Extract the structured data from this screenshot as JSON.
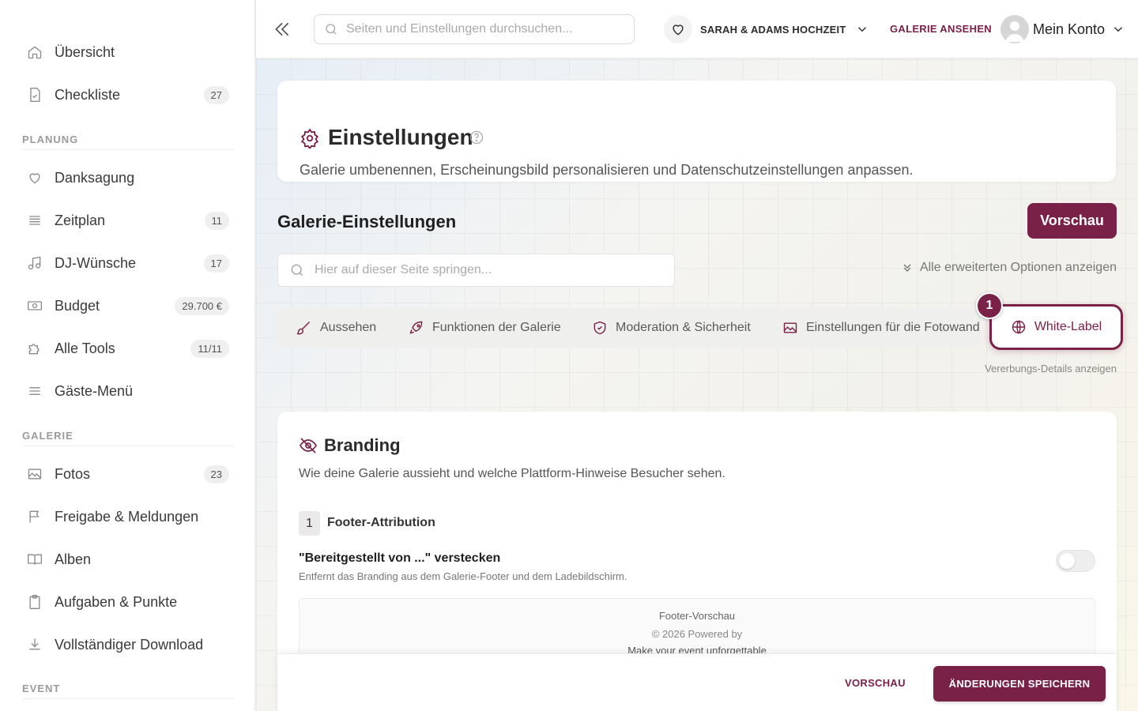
{
  "sidebar": {
    "items": [
      {
        "label": "Übersicht",
        "icon": "home-icon"
      },
      {
        "label": "Checkliste",
        "icon": "checklist-icon",
        "badge": "27"
      },
      {
        "label": "Danksagung",
        "icon": "heart-icon"
      },
      {
        "label": "Zeitplan",
        "icon": "schedule-icon",
        "badge": "11"
      },
      {
        "label": "DJ-Wünsche",
        "icon": "music-icon",
        "badge": "17"
      },
      {
        "label": "Budget",
        "icon": "money-icon",
        "badge": "29.700 €"
      },
      {
        "label": "Alle Tools",
        "icon": "puzzle-icon",
        "badge": "11/11"
      },
      {
        "label": "Gäste-Menü",
        "icon": "menu-icon"
      },
      {
        "label": "Fotos",
        "icon": "image-icon",
        "badge": "23"
      },
      {
        "label": "Freigabe & Meldungen",
        "icon": "flag-icon"
      },
      {
        "label": "Alben",
        "icon": "book-icon"
      },
      {
        "label": "Aufgaben & Punkte",
        "icon": "clipboard-icon"
      },
      {
        "label": "Vollständiger Download",
        "icon": "download-icon"
      }
    ],
    "sections": {
      "planung": "PLANUNG",
      "galerie": "GALERIE",
      "event": "EVENT"
    }
  },
  "topbar": {
    "search_placeholder": "Seiten und Einstellungen durchsuchen...",
    "event_name": "SARAH & ADAMS HOCHZEIT",
    "gallery_link": "GALERIE ANSEHEN",
    "account_label": "Mein Konto"
  },
  "header": {
    "title": "Einstellungen",
    "description": "Galerie umbenennen, Erscheinungsbild personalisieren und Datenschutzeinstellungen anpassen."
  },
  "gallery_settings": {
    "title": "Galerie-Einstellungen",
    "preview_button": "Vorschau",
    "jump_placeholder": "Hier auf dieser Seite springen...",
    "advanced_link": "Alle erweiterten Optionen anzeigen",
    "tabs": [
      {
        "label": "Aussehen",
        "icon": "brush-icon"
      },
      {
        "label": "Funktionen der Galerie",
        "icon": "rocket-icon"
      },
      {
        "label": "Moderation & Sicherheit",
        "icon": "shield-icon"
      },
      {
        "label": "Einstellungen für die Fotowand",
        "icon": "image-icon"
      }
    ],
    "active_tab": {
      "label": "White-Label",
      "icon": "globe-icon"
    },
    "step_badge": "1",
    "inherit_link": "Vererbungs-Details anzeigen"
  },
  "branding": {
    "title": "Branding",
    "description": "Wie deine Galerie aussieht und welche Plattform-Hinweise Besucher sehen.",
    "section_number": "1",
    "section_title": "Footer-Attribution",
    "option_title": "\"Bereitgestellt von ...\" verstecken",
    "option_description": "Entfernt das Branding aus dem Galerie-Footer und dem Ladebildschirm.",
    "toggle_on": false,
    "footer_preview": {
      "label": "Footer-Vorschau",
      "powered": "© 2026 Powered by",
      "slogan": "Make your event unforgettable"
    }
  },
  "bottom_bar": {
    "preview": "VORSCHAU",
    "save": "ÄNDERUNGEN SPEICHERN"
  },
  "colors": {
    "accent": "#7a2148"
  }
}
